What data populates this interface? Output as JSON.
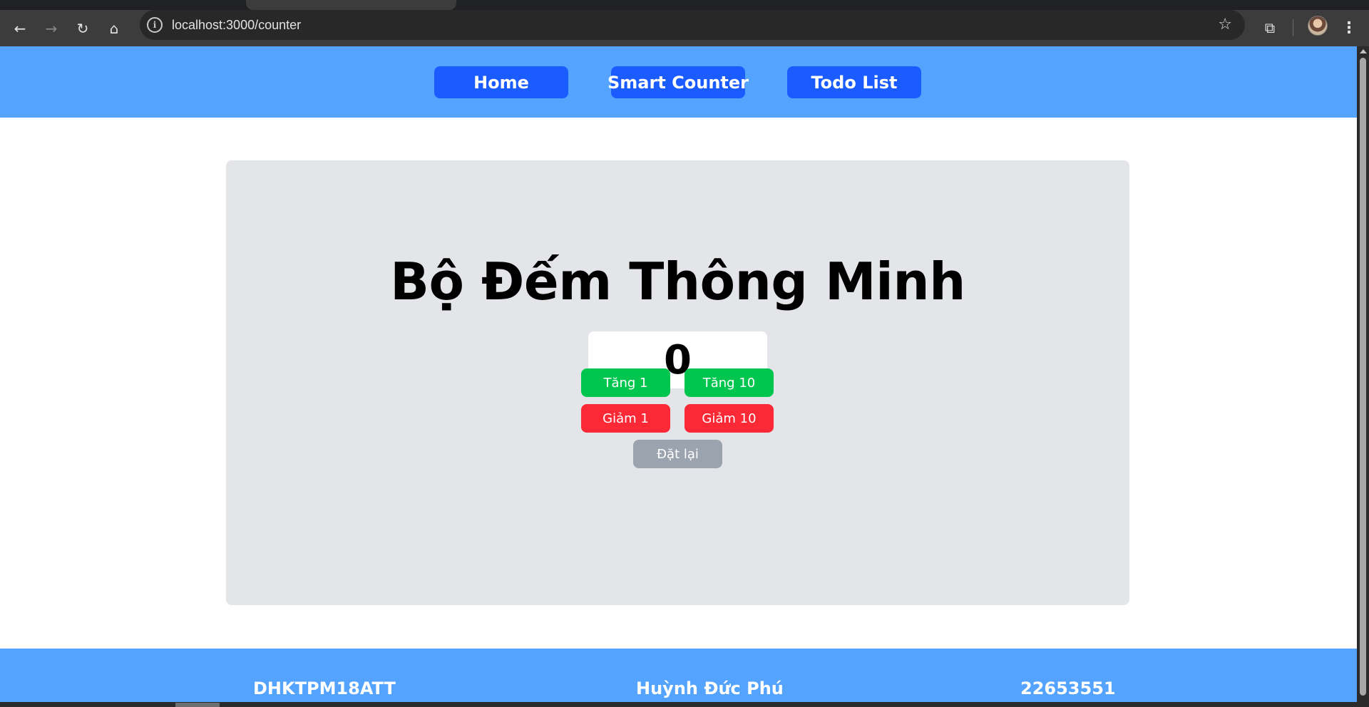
{
  "browser": {
    "url": "localhost:3000/counter",
    "back_icon": "←",
    "forward_icon": "→",
    "reload_icon": "↻",
    "home_icon": "⌂",
    "star_icon": "☆",
    "info_icon": "i",
    "extensions_icon": "⧉",
    "menu_icon": "⋮"
  },
  "nav": {
    "links": [
      {
        "label": "Home"
      },
      {
        "label": "Smart Counter"
      },
      {
        "label": "Todo List"
      }
    ],
    "color": "#54a3ff",
    "button_color": "#1a5cff"
  },
  "counter": {
    "title": "Bộ Đếm Thông Minh",
    "value": "0",
    "buttons": {
      "inc1": "Tăng 1",
      "inc10": "Tăng 10",
      "dec1": "Giảm 1",
      "dec10": "Giảm 10",
      "reset": "Đặt lại"
    },
    "colors": {
      "increase": "#00c54f",
      "decrease": "#fb2836",
      "reset": "#9ba3af"
    }
  },
  "footer": {
    "class_code": "DHKTPM18ATT",
    "student_name": "Huỳnh Đức Phú",
    "student_id": "22653551"
  }
}
